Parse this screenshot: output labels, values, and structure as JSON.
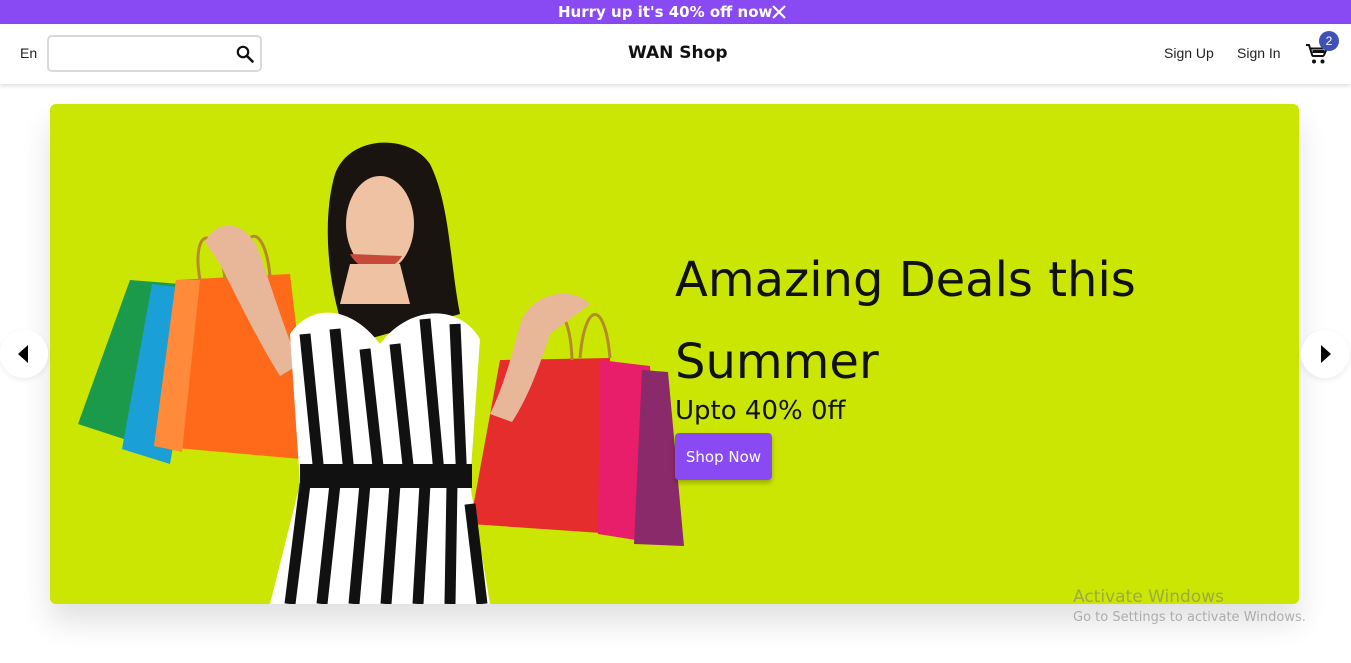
{
  "promo": {
    "text": "Hurry up it's 40% off now",
    "close_icon": "close-icon",
    "background": "#8a4af3"
  },
  "header": {
    "language": "En",
    "search": {
      "value": "",
      "placeholder": "",
      "icon": "search-icon"
    },
    "brand": "WAN Shop",
    "sign_up": "Sign Up",
    "sign_in": "Sign In",
    "cart": {
      "icon": "cart-icon",
      "count": "2",
      "badge_color": "#3f51b5"
    }
  },
  "hero": {
    "title": "Amazing Deals this Summer",
    "subtitle": "Upto 40% 0ff",
    "cta": "Shop Now",
    "background": "#cbe602",
    "cta_color": "#8a4af3",
    "prev_icon": "arrow-left-icon",
    "next_icon": "arrow-right-icon"
  },
  "watermark": {
    "title": "Activate Windows",
    "subtitle": "Go to Settings to activate Windows."
  }
}
